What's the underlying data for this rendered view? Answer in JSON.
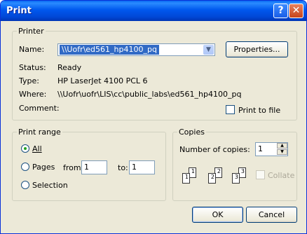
{
  "window": {
    "title": "Print",
    "help_button": "?",
    "close_button": "✕"
  },
  "printer": {
    "legend": "Printer",
    "name_label": "Name:",
    "name_value": "\\\\Uofr\\ed561_hp4100_pq",
    "properties_label": "Properties...",
    "status_label": "Status:",
    "status_value": "Ready",
    "type_label": "Type:",
    "type_value": "HP LaserJet 4100 PCL 6",
    "where_label": "Where:",
    "where_value": "\\\\Uofr\\uofr\\LIS\\cc\\public_labs\\ed561_hp4100_pq",
    "comment_label": "Comment:",
    "print_to_file_label": "Print to file",
    "print_to_file_checked": false
  },
  "print_range": {
    "legend": "Print range",
    "all_label": "All",
    "pages_label": "Pages",
    "from_label": "from:",
    "from_value": "1",
    "to_label": "to:",
    "to_value": "1",
    "selection_label": "Selection",
    "selected": "All"
  },
  "copies": {
    "legend": "Copies",
    "number_label": "Number of copies:",
    "number_value": "1",
    "collate_label": "Collate",
    "collate_checked": false,
    "collate_pages": [
      "1",
      "1",
      "2",
      "2",
      "3",
      "3"
    ]
  },
  "buttons": {
    "ok": "OK",
    "cancel": "Cancel"
  }
}
